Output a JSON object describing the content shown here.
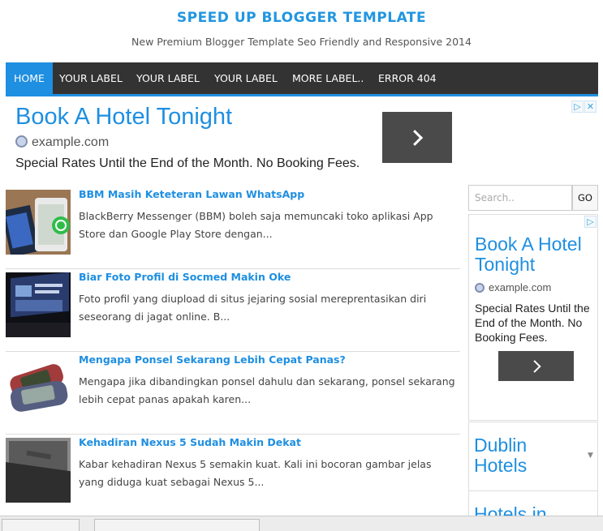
{
  "header": {
    "title": "SPEED UP BLOGGER TEMPLATE",
    "description": "New Premium Blogger Template Seo Friendly and Responsive 2014"
  },
  "nav": {
    "items": [
      {
        "label": "HOME",
        "active": true
      },
      {
        "label": "YOUR LABEL"
      },
      {
        "label": "YOUR LABEL"
      },
      {
        "label": "YOUR LABEL"
      },
      {
        "label": "MORE LABEL.."
      },
      {
        "label": "ERROR 404"
      }
    ]
  },
  "ad_top": {
    "headline": "Book A Hotel Tonight",
    "url": "example.com",
    "description": "Special Rates Until the End of the Month. No Booking Fees."
  },
  "posts": [
    {
      "title": "BBM Masih Keteteran Lawan WhatsApp",
      "snippet": "BlackBerry Messenger (BBM) boleh saja memuncaki toko aplikasi App Store dan Google Play Store dengan..."
    },
    {
      "title": "Biar Foto Profil di Socmed Makin Oke",
      "snippet": "Foto profil yang diupload di situs jejaring sosial mereprentasikan diri seseorang di jagat online. B..."
    },
    {
      "title": "Mengapa Ponsel Sekarang Lebih Cepat Panas?",
      "snippet": "Mengapa jika dibandingkan ponsel dahulu dan sekarang, ponsel sekarang lebih cepat panas apakah karen..."
    },
    {
      "title": "Kehadiran Nexus 5 Sudah Makin Dekat",
      "snippet": "Kabar kehadiran Nexus 5 semakin kuat. Kali ini bocoran gambar jelas yang diduga kuat sebagai Nexus 5..."
    }
  ],
  "sidebar": {
    "search_placeholder": "Search..",
    "go_label": "GO",
    "ad": {
      "headline": "Book A Hotel Tonight",
      "url": "example.com",
      "description": "Special Rates Until the End of the Month. No Booking Fees."
    },
    "ad_list": [
      "Dublin Hotels",
      "Hotels in"
    ]
  },
  "icons": {
    "ad_choices": "adchoices-icon",
    "close": "close-icon",
    "globe": "globe-icon",
    "arrow": "chevron-right-icon"
  },
  "colors": {
    "accent": "#1e8fe1",
    "nav_bg": "#333333"
  }
}
